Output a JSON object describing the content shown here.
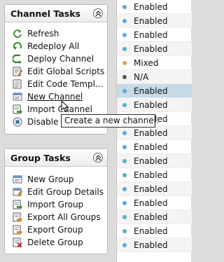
{
  "channel_tasks": {
    "title": "Channel Tasks",
    "collapse_glyph": "«",
    "items": [
      {
        "label": "Refresh",
        "icon": "refresh-icon"
      },
      {
        "label": "Redeploy All",
        "icon": "redeploy-icon"
      },
      {
        "label": "Deploy Channel",
        "icon": "deploy-icon"
      },
      {
        "label": "Edit Global Scripts",
        "icon": "edit-scripts-icon"
      },
      {
        "label": "Edit Code Templ...",
        "icon": "code-template-icon"
      },
      {
        "label": "New Channel",
        "icon": "new-channel-icon"
      },
      {
        "label": "Import Channel",
        "icon": "import-channel-icon"
      },
      {
        "label": "Disable Channel",
        "icon": "disable-channel-icon"
      }
    ]
  },
  "group_tasks": {
    "title": "Group Tasks",
    "collapse_glyph": "«",
    "items": [
      {
        "label": "New Group",
        "icon": "new-group-icon"
      },
      {
        "label": "Edit Group Details",
        "icon": "edit-group-icon"
      },
      {
        "label": "Import Group",
        "icon": "import-group-icon"
      },
      {
        "label": "Export All Groups",
        "icon": "export-all-groups-icon"
      },
      {
        "label": "Export Group",
        "icon": "export-group-icon"
      },
      {
        "label": "Delete Group",
        "icon": "delete-group-icon"
      }
    ]
  },
  "tooltip": {
    "text": "Create a new channel."
  },
  "status_column": {
    "rows": [
      {
        "text": "Enabled",
        "color": "#5aa9d6"
      },
      {
        "text": "Enabled",
        "color": "#5aa9d6"
      },
      {
        "text": "Enabled",
        "color": "#5aa9d6"
      },
      {
        "text": "Enabled",
        "color": "#5aa9d6"
      },
      {
        "text": "Mixed",
        "color": "#e8a040"
      },
      {
        "text": "N/A",
        "color": "#555555"
      },
      {
        "text": "Enabled",
        "color": "#5aa9d6"
      },
      {
        "text": "Enabled",
        "color": "#5aa9d6"
      },
      {
        "text": "Enabled",
        "color": "#5aa9d6"
      },
      {
        "text": "Enabled",
        "color": "#5aa9d6"
      },
      {
        "text": "Enabled",
        "color": "#5aa9d6"
      },
      {
        "text": "Enabled",
        "color": "#5aa9d6"
      },
      {
        "text": "Enabled",
        "color": "#5aa9d6"
      },
      {
        "text": "Enabled",
        "color": "#5aa9d6"
      },
      {
        "text": "Enabled",
        "color": "#5aa9d6"
      },
      {
        "text": "Enabled",
        "color": "#5aa9d6"
      },
      {
        "text": "Enabled",
        "color": "#5aa9d6"
      },
      {
        "text": "Enabled",
        "color": "#5aa9d6"
      }
    ],
    "selected_row": 6
  }
}
